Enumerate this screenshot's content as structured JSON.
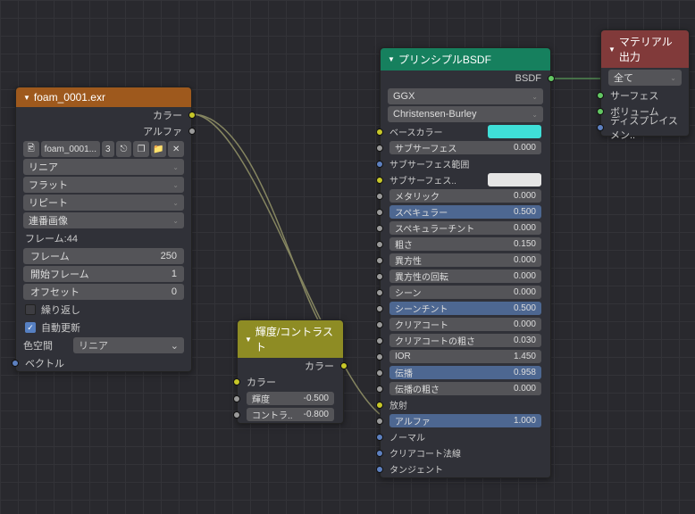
{
  "image_node": {
    "title": "foam_0001.exr",
    "out_color": "カラー",
    "out_alpha": "アルファ",
    "file_name": "foam_0001...",
    "file_count": "3",
    "interp": "リニア",
    "projection": "フラット",
    "extension": "リピート",
    "source": "連番画像",
    "frame_label": "フレーム:44",
    "frame": "フレーム",
    "frame_val": "250",
    "start": "開始フレーム",
    "start_val": "1",
    "offset": "オフセット",
    "offset_val": "0",
    "cyclic": "繰り返し",
    "auto_refresh": "自動更新",
    "colorspace_label": "色空間",
    "colorspace": "リニア",
    "in_vector": "ベクトル"
  },
  "bc_node": {
    "title": "輝度/コントラスト",
    "out_color": "カラー",
    "in_color": "カラー",
    "bright": "輝度",
    "bright_val": "-0.500",
    "contrast": "コントラ..",
    "contrast_val": "-0.800"
  },
  "bsdf_node": {
    "title": "プリンシプルBSDF",
    "out_bsdf": "BSDF",
    "dist": "GGX",
    "sss": "Christensen-Burley",
    "base_color": "ベースカラー",
    "base_color_hex": "#3fdfd8",
    "subsurface": "サブサーフェス",
    "subsurface_val": "0.000",
    "subsurf_rad": "サブサーフェス範囲",
    "subsurf_col": "サブサーフェス..",
    "subsurf_col_hex": "#e5e5e5",
    "metallic": "メタリック",
    "metallic_val": "0.000",
    "specular": "スペキュラー",
    "specular_val": "0.500",
    "spec_tint": "スペキュラーチント",
    "spec_tint_val": "0.000",
    "roughness": "粗さ",
    "roughness_val": "0.150",
    "aniso": "異方性",
    "aniso_val": "0.000",
    "aniso_rot": "異方性の回転",
    "aniso_rot_val": "0.000",
    "sheen": "シーン",
    "sheen_val": "0.000",
    "sheen_tint": "シーンチント",
    "sheen_tint_val": "0.500",
    "clearcoat": "クリアコート",
    "clearcoat_val": "0.000",
    "cc_rough": "クリアコートの粗さ",
    "cc_rough_val": "0.030",
    "ior": "IOR",
    "ior_val": "1.450",
    "trans": "伝播",
    "trans_val": "0.958",
    "trans_rough": "伝播の粗さ",
    "trans_rough_val": "0.000",
    "emission": "放射",
    "alpha": "アルファ",
    "alpha_val": "1.000",
    "normal": "ノーマル",
    "cc_normal": "クリアコート法線",
    "tangent": "タンジェント"
  },
  "out_node": {
    "title": "マテリアル出力",
    "target": "全て",
    "surface": "サーフェス",
    "volume": "ボリューム",
    "displace": "ディスプレイスメン.."
  }
}
